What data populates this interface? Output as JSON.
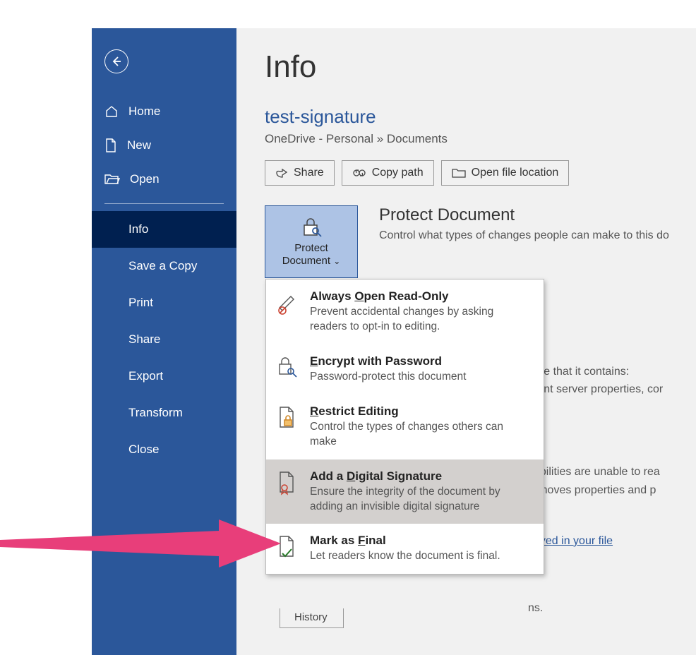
{
  "sidebar": {
    "items_top": [
      {
        "label": "Home"
      },
      {
        "label": "New"
      },
      {
        "label": "Open"
      }
    ],
    "items_bottom": [
      {
        "label": "Info",
        "active": true
      },
      {
        "label": "Save a Copy"
      },
      {
        "label": "Print"
      },
      {
        "label": "Share"
      },
      {
        "label": "Export"
      },
      {
        "label": "Transform"
      },
      {
        "label": "Close"
      }
    ]
  },
  "page": {
    "title": "Info",
    "doc_title": "test-signature",
    "breadcrumb": "OneDrive - Personal » Documents"
  },
  "toolbar": {
    "share": "Share",
    "copy_path": "Copy path",
    "open_loc": "Open file location"
  },
  "protect": {
    "button_line1": "Protect",
    "button_line2": "Document",
    "heading": "Protect Document",
    "desc": "Control what types of changes people can make to this do"
  },
  "dropdown": [
    {
      "title_pre": "Always ",
      "title_u": "O",
      "title_post": "pen Read-Only",
      "desc": "Prevent accidental changes by asking readers to opt-in to editing."
    },
    {
      "title_pre": "",
      "title_u": "E",
      "title_post": "ncrypt with Password",
      "desc": "Password-protect this document"
    },
    {
      "title_pre": "",
      "title_u": "R",
      "title_post": "estrict Editing",
      "desc": "Control the types of changes others can make"
    },
    {
      "title_pre": "Add a ",
      "title_u": "D",
      "title_post": "igital Signature",
      "desc": "Ensure the integrity of the document by adding an invisible digital signature"
    },
    {
      "title_pre": "Mark as ",
      "title_u": "F",
      "title_post": "inal",
      "desc": "Let readers know the document is final."
    }
  ],
  "bg_fragments": {
    "a": "vare that it contains:",
    "b": "ment server properties, cor",
    "c": "sabilities are unable to rea",
    "d": "removes properties and p",
    "e": "saved in your file",
    "f": "ns.",
    "history": "History"
  }
}
